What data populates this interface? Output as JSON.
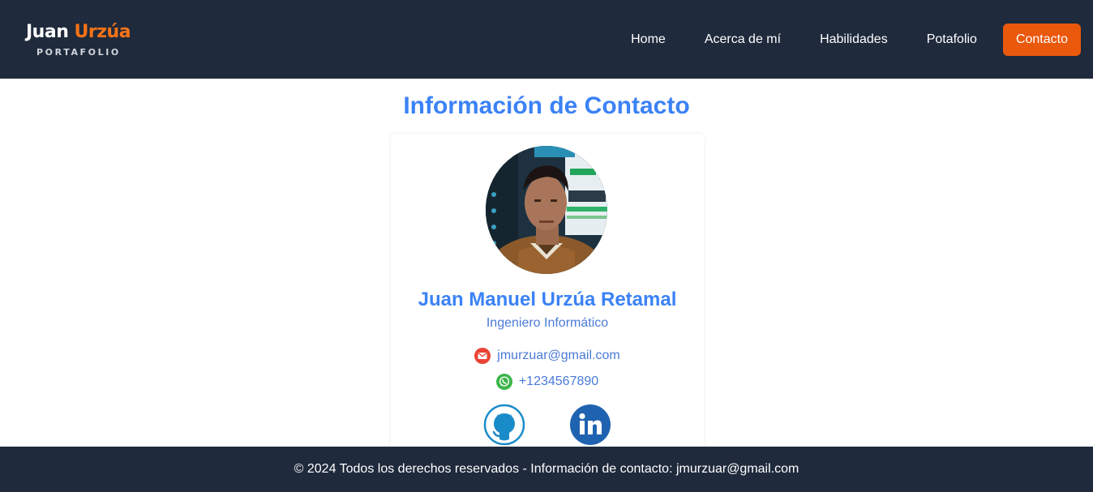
{
  "header": {
    "logo": {
      "first": "Juan",
      "last": "Urzúa",
      "subtitle": "PORTAFOLIO"
    },
    "nav": [
      {
        "label": "Home"
      },
      {
        "label": "Acerca de mí"
      },
      {
        "label": "Habilidades"
      },
      {
        "label": "Potafolio"
      },
      {
        "label": "Contacto",
        "active": true
      }
    ]
  },
  "main": {
    "title": "Información de Contacto",
    "card": {
      "name": "Juan Manuel Urzúa Retamal",
      "role": "Ingeniero Informático",
      "email": "jmurzuar@gmail.com",
      "phone": "+1234567890",
      "social": [
        {
          "icon": "github-icon"
        },
        {
          "icon": "linkedin-icon"
        }
      ]
    }
  },
  "footer": {
    "text": "© 2024 Todos los derechos reservados - Información de contacto: jmurzuar@gmail.com"
  },
  "colors": {
    "header_bg": "#1f2a3c",
    "accent_orange": "#ea580c",
    "accent_blue": "#3b82f6",
    "gmail_red": "#ea4335",
    "whatsapp_green": "#25d366",
    "github_blue": "#1a8bc9",
    "linkedin_blue": "#1f63b0"
  }
}
